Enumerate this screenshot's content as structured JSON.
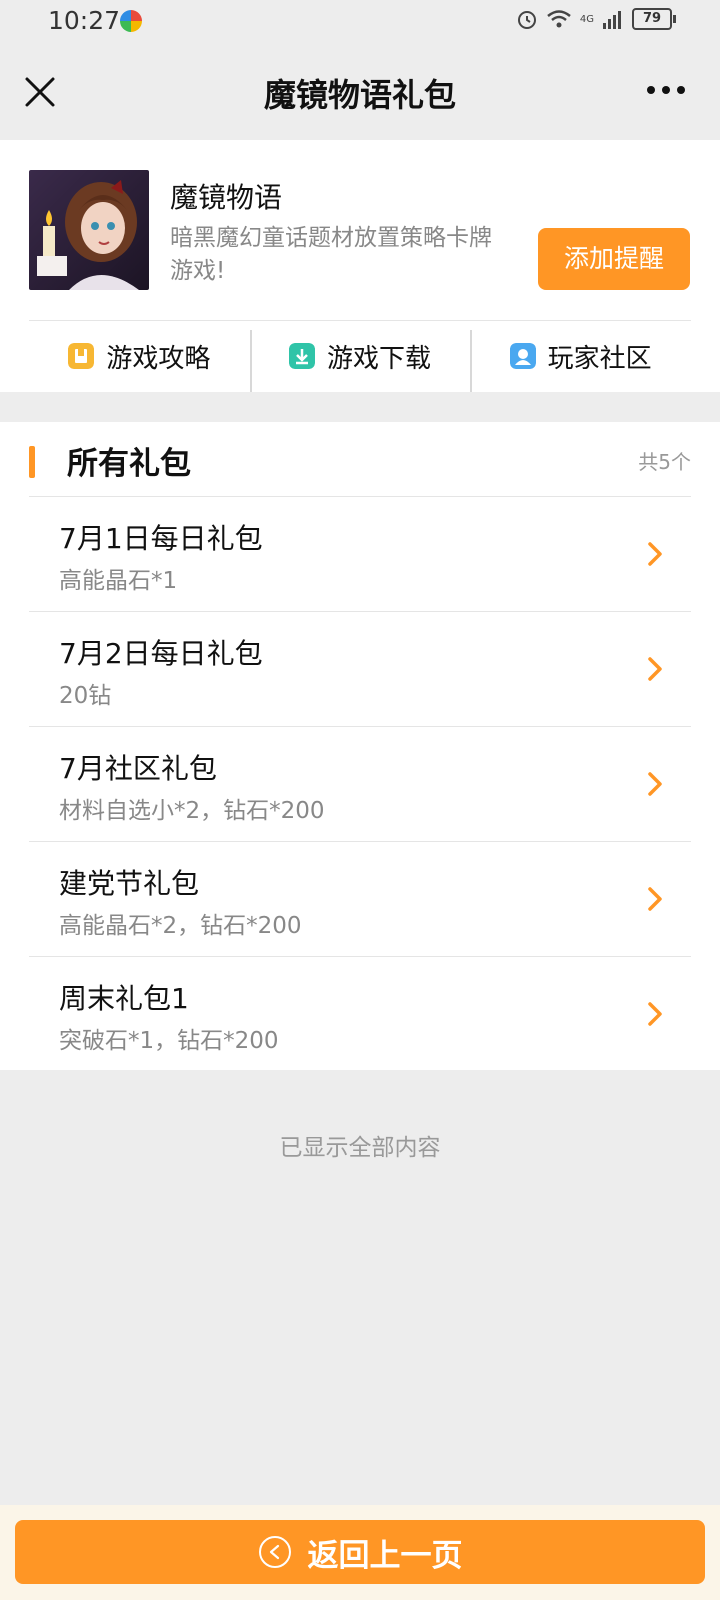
{
  "status_bar": {
    "time": "10:27",
    "network": "4G",
    "battery": "79"
  },
  "nav": {
    "title": "魔镜物语礼包"
  },
  "game": {
    "name": "魔镜物语",
    "description": "暗黑魔幻童话题材放置策略卡牌游戏!",
    "remind_button": "添加提醒"
  },
  "quick_links": [
    {
      "label": "游戏攻略",
      "icon": "guide-icon",
      "color": "#f7b733"
    },
    {
      "label": "游戏下载",
      "icon": "download-icon",
      "color": "#2fc4a8"
    },
    {
      "label": "玩家社区",
      "icon": "community-icon",
      "color": "#4aa8f0"
    }
  ],
  "gifts_section": {
    "title": "所有礼包",
    "count": "共5个",
    "items": [
      {
        "title": "7月1日每日礼包",
        "desc": "高能晶石*1"
      },
      {
        "title": "7月2日每日礼包",
        "desc": "20钻"
      },
      {
        "title": "7月社区礼包",
        "desc": "材料自选小*2，钻石*200"
      },
      {
        "title": "建党节礼包",
        "desc": "高能晶石*2，钻石*200"
      },
      {
        "title": "周末礼包1",
        "desc": "突破石*1，钻石*200"
      }
    ]
  },
  "end_text": "已显示全部内容",
  "footer": {
    "back_label": "返回上一页"
  },
  "colors": {
    "accent": "#ff9625",
    "background": "#ededed"
  }
}
